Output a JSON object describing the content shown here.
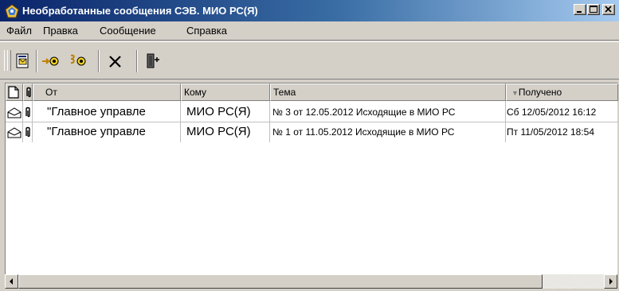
{
  "window": {
    "title": "Необработанные сообщения СЭВ. МИО РС(Я)",
    "app_icon": "app-icon"
  },
  "menu": {
    "items": [
      {
        "label": "Файл"
      },
      {
        "label": "Правка"
      },
      {
        "label": "Сообщение"
      },
      {
        "label": "Справка"
      }
    ]
  },
  "toolbar": {
    "buttons": [
      {
        "icon": "open-message-icon"
      },
      {
        "icon": "forward-message-icon"
      },
      {
        "icon": "process-message-icon"
      },
      {
        "icon": "delete-icon"
      },
      {
        "icon": "exit-icon"
      }
    ]
  },
  "list": {
    "columns": {
      "icon": "",
      "attach": "",
      "from": "От",
      "to": "Кому",
      "subject": "Тема",
      "received": "Получено"
    },
    "sort_column": "received",
    "rows": [
      {
        "from": "\"Главное управле",
        "to": "МИО РС(Я)",
        "subject": "№ 3 от 12.05.2012 Исходящие в МИО РС",
        "received": "Сб 12/05/2012 16:12"
      },
      {
        "from": "\"Главное управле",
        "to": "МИО РС(Я)",
        "subject": "№ 1 от 11.05.2012 Исходящие в МИО РС",
        "received": "Пт 11/05/2012 18:54"
      }
    ]
  },
  "colors": {
    "titlebar_start": "#0a246a",
    "titlebar_end": "#a6caf0",
    "face": "#d4d0c8"
  }
}
